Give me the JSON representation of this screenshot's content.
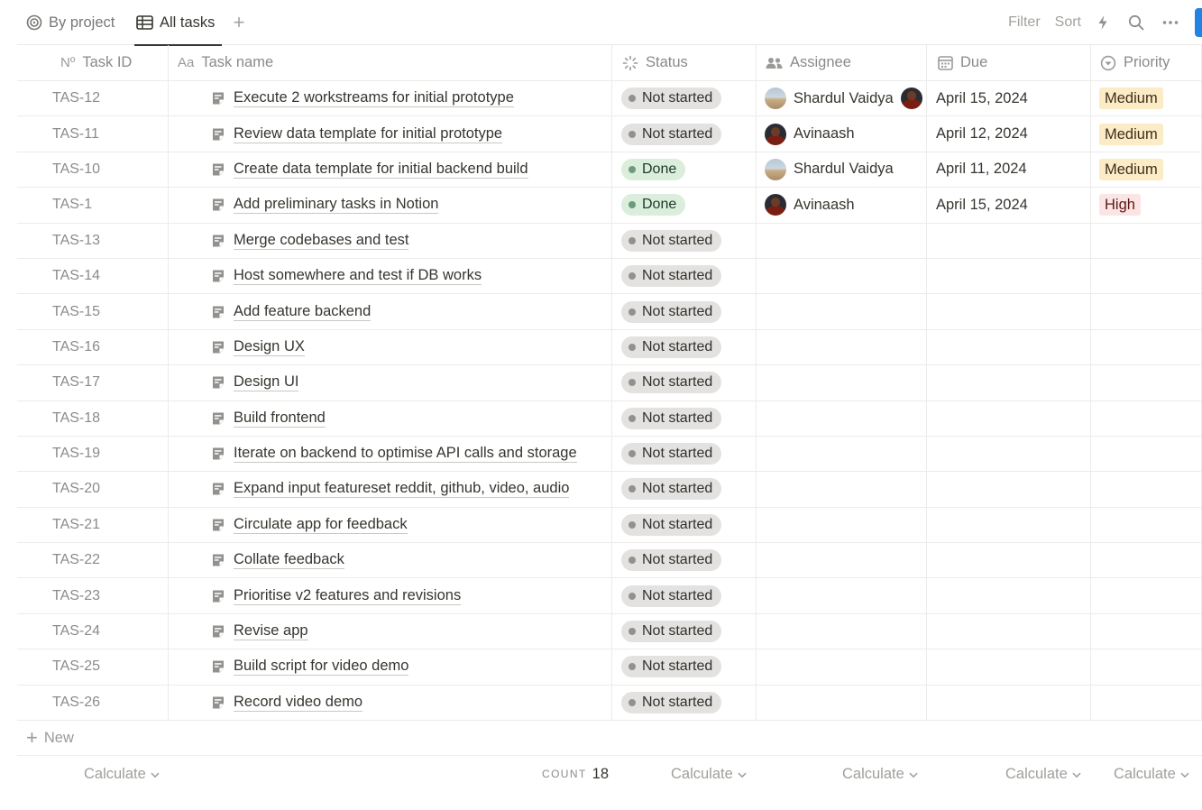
{
  "views": {
    "by_project": "By project",
    "all_tasks": "All tasks",
    "add": "+"
  },
  "toolbar": {
    "filter": "Filter",
    "sort": "Sort",
    "automation_icon": "lightning-icon",
    "search_icon": "search-icon",
    "more_icon": "ellipsis-icon"
  },
  "columns": {
    "task_id": "Task ID",
    "task_id_icon": "Nº",
    "task_name": "Task name",
    "task_name_icon": "Aa",
    "status": "Status",
    "assignee": "Assignee",
    "due": "Due",
    "priority": "Priority"
  },
  "rows": [
    {
      "id": "TAS-12",
      "name": "Execute 2 workstreams for initial prototype",
      "status": "Not started",
      "assignee": "Shardul Vaidya",
      "assignee_avatar": "landscape",
      "extra_avatar": true,
      "due": "April 15, 2024",
      "priority": "Medium"
    },
    {
      "id": "TAS-11",
      "name": "Review data template for initial prototype",
      "status": "Not started",
      "assignee": "Avinaash",
      "assignee_avatar": "portrait",
      "due": "April 12, 2024",
      "priority": "Medium"
    },
    {
      "id": "TAS-10",
      "name": "Create data template for initial backend build",
      "status": "Done",
      "assignee": "Shardul Vaidya",
      "assignee_avatar": "landscape",
      "due": "April 11, 2024",
      "priority": "Medium"
    },
    {
      "id": "TAS-1",
      "name": "Add preliminary tasks in Notion",
      "status": "Done",
      "assignee": "Avinaash",
      "assignee_avatar": "portrait",
      "due": "April 15, 2024",
      "priority": "High"
    },
    {
      "id": "TAS-13",
      "name": "Merge codebases and test",
      "status": "Not started"
    },
    {
      "id": "TAS-14",
      "name": "Host somewhere and test if DB works",
      "status": "Not started"
    },
    {
      "id": "TAS-15",
      "name": "Add feature backend",
      "status": "Not started"
    },
    {
      "id": "TAS-16",
      "name": "Design UX",
      "status": "Not started"
    },
    {
      "id": "TAS-17",
      "name": "Design UI",
      "status": "Not started"
    },
    {
      "id": "TAS-18",
      "name": "Build frontend",
      "status": "Not started"
    },
    {
      "id": "TAS-19",
      "name": "Iterate on backend to optimise API calls and storage",
      "status": "Not started"
    },
    {
      "id": "TAS-20",
      "name": "Expand input featureset reddit, github, video, audio",
      "status": "Not started"
    },
    {
      "id": "TAS-21",
      "name": "Circulate app for feedback",
      "status": "Not started"
    },
    {
      "id": "TAS-22",
      "name": "Collate feedback",
      "status": "Not started"
    },
    {
      "id": "TAS-23",
      "name": "Prioritise v2 features and revisions",
      "status": "Not started"
    },
    {
      "id": "TAS-24",
      "name": "Revise app",
      "status": "Not started"
    },
    {
      "id": "TAS-25",
      "name": "Build script for video demo",
      "status": "Not started"
    },
    {
      "id": "TAS-26",
      "name": "Record video demo",
      "status": "Not started"
    }
  ],
  "new_row": {
    "label": "New"
  },
  "footer": {
    "calculate": "Calculate",
    "count_label": "COUNT",
    "count_value": "18"
  },
  "colors": {
    "accent": "#2383e2",
    "not_started_bg": "#e3e2e0",
    "done_bg": "#dbeddb",
    "medium_bg": "#fbecc6",
    "high_bg": "#fbe4e4"
  }
}
